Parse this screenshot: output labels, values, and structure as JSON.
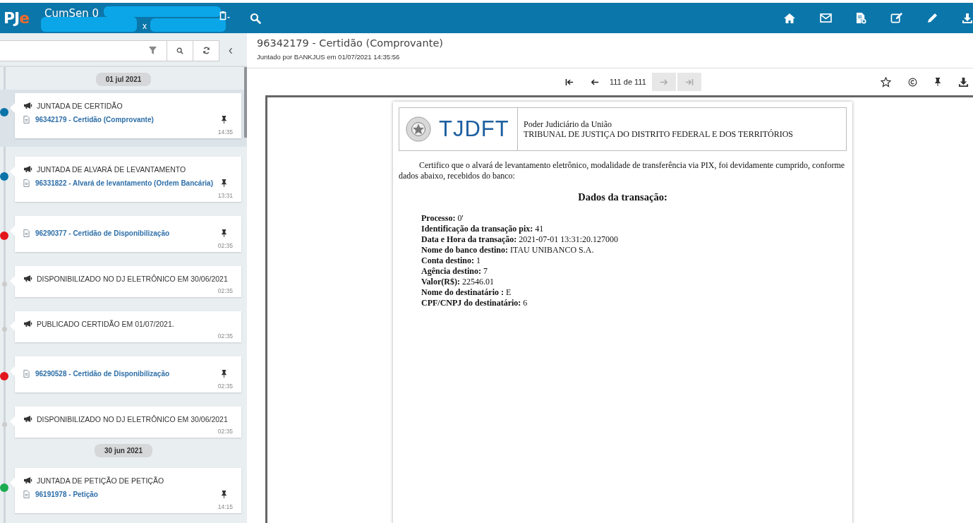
{
  "topbar": {
    "logo": {
      "part_1": "PJ",
      "part_2": "e"
    },
    "case_title": "CumSen 0",
    "case_subtitle": "x"
  },
  "left_panel": {
    "timeline": [
      {
        "kind": "date",
        "label": "01 jul 2021"
      },
      {
        "kind": "event",
        "color": "#0a73a8",
        "selected": true,
        "title": "JUNTADA DE CERTIDÃO",
        "document": "96342179 - Certidão (Comprovante)",
        "time": "14:35"
      },
      {
        "kind": "event",
        "color": "#0a73a8",
        "selected": false,
        "title": "JUNTADA DE ALVARÁ DE LEVANTAMENTO",
        "document": "96331822 - Alvará de levantamento (Ordem Bancária)",
        "time": "13:31"
      },
      {
        "kind": "event",
        "color": "#e3141b",
        "selected": false,
        "document": "96290377 - Certidão de Disponibilização",
        "time": "02:35"
      },
      {
        "kind": "event",
        "color": "#cccccc",
        "selected": false,
        "title": "DISPONIBILIZADO NO DJ ELETRÔNICO EM 30/06/2021",
        "time": "02:35"
      },
      {
        "kind": "event",
        "color": "#cccccc",
        "selected": false,
        "title": "PUBLICADO CERTIDÃO EM 01/07/2021.",
        "time": "02:35"
      },
      {
        "kind": "event",
        "color": "#e3141b",
        "selected": false,
        "document": "96290528 - Certidão de Disponibilização",
        "time": "02:35"
      },
      {
        "kind": "event",
        "color": "#cccccc",
        "selected": false,
        "title": "DISPONIBILIZADO NO DJ ELETRÔNICO EM 30/06/2021",
        "time": "02:35"
      },
      {
        "kind": "date",
        "label": "30 jun 2021"
      },
      {
        "kind": "event",
        "color": "#1aab4f",
        "selected": false,
        "title": "JUNTADA DE PETIÇÃO DE PETIÇÃO",
        "document": "96191978 - Petição",
        "time": "14:15"
      }
    ]
  },
  "document_header": {
    "title": "96342179 - Certidão (Comprovante)",
    "subtitle": "Juntado por BANKJUS em 01/07/2021 14:35:56"
  },
  "pager": {
    "label": "111 de 111",
    "buttons": [
      {
        "kind": "first",
        "disabled": false
      },
      {
        "kind": "prev",
        "disabled": false
      },
      {
        "kind": "next",
        "disabled": true
      },
      {
        "kind": "last",
        "disabled": true
      }
    ]
  },
  "document": {
    "logo_text": "TJDFT",
    "org_line_1": "Poder Judiciário da União",
    "org_line_2": "TRIBUNAL DE JUSTIÇA DO DISTRITO FEDERAL E DOS TERRITÓRIOS",
    "paragraph": "Certifico que o alvará de levantamento eletrônico, modalidade de transferência via PIX, foi devidamente cumprido, conforme dados abaixo, recebidos do banco:",
    "heading": "Dados da transação:",
    "fields": [
      {
        "label": "Processo:",
        "value": "0'"
      },
      {
        "label": "Identificação da transação pix:",
        "value": "41"
      },
      {
        "label": "Data e Hora da transação:",
        "value": "2021-07-01 13:31:20.127000"
      },
      {
        "label": "Nome do banco destino:",
        "value": "ITAU UNIBANCO S.A."
      },
      {
        "label": "Conta destino:",
        "value": "1"
      },
      {
        "label": "Agência destino:",
        "value": "7"
      },
      {
        "label": "Valor(R$):",
        "value": "22546.01"
      },
      {
        "label": "Nome do destinatário :",
        "value": "E"
      },
      {
        "label": "CPF/CNPJ do destinatário:",
        "value": "6"
      }
    ]
  }
}
